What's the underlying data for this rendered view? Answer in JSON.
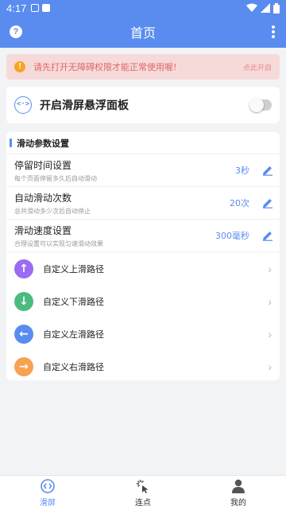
{
  "status": {
    "time": "4:17"
  },
  "header": {
    "help_icon": "?",
    "title": "首页"
  },
  "notice": {
    "message": "请先打开无障碍权限才能正常使用喔!",
    "action": "点此开启"
  },
  "floating_panel": {
    "icon": "<·>",
    "label": "开启滑屏悬浮面板",
    "enabled": false
  },
  "params": {
    "section_title": "滑动参数设置",
    "settings": [
      {
        "title": "停留时间设置",
        "desc": "每个页面停留多久后自动滑动",
        "value": "3秒"
      },
      {
        "title": "自动滑动次数",
        "desc": "总共滑动多少次后自动停止",
        "value": "20次"
      },
      {
        "title": "滑动速度设置",
        "desc": "合理设置可以实现匀速滑动效果",
        "value": "300毫秒"
      }
    ],
    "paths": [
      {
        "label": "自定义上滑路径",
        "arrow": "↑",
        "color": "#9b6bf2"
      },
      {
        "label": "自定义下滑路径",
        "arrow": "↓",
        "color": "#4cbb7f"
      },
      {
        "label": "自定义左滑路径",
        "arrow": "←",
        "color": "#5a8cf0"
      },
      {
        "label": "自定义右滑路径",
        "arrow": "→",
        "color": "#f7a151"
      }
    ]
  },
  "nav": {
    "tabs": [
      {
        "label": "滑屏",
        "icon": "code-icon",
        "active": true
      },
      {
        "label": "连点",
        "icon": "tap-cursor-icon",
        "active": false
      },
      {
        "label": "我的",
        "icon": "person-icon",
        "active": false
      }
    ]
  },
  "colors": {
    "accent": "#5a8cf0",
    "notice_bg": "#f6dada",
    "notice_text": "#e06666"
  }
}
